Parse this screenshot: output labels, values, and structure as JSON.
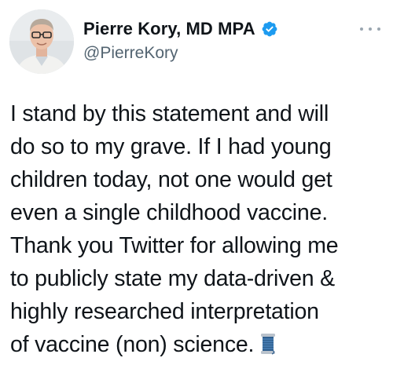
{
  "author": {
    "display_name": "Pierre Kory, MD MPA",
    "handle": "@PierreKory",
    "verified": true
  },
  "tweet": {
    "lines": [
      "I stand by this statement and will",
      "do so to my grave. If I had young",
      "children today, not one would get",
      "even a single childhood vaccine.",
      "Thank you Twitter for allowing me",
      "to publicly state my data-driven &",
      "highly researched interpretation",
      "of vaccine (non) science."
    ],
    "trailing_emoji": "spool-of-thread-emoji"
  },
  "icons": {
    "verified": "verified-badge-icon",
    "more": "more-options-icon"
  },
  "colors": {
    "verified_blue": "#1d9bf0",
    "text": "#0f1419",
    "secondary_text": "#536471"
  }
}
